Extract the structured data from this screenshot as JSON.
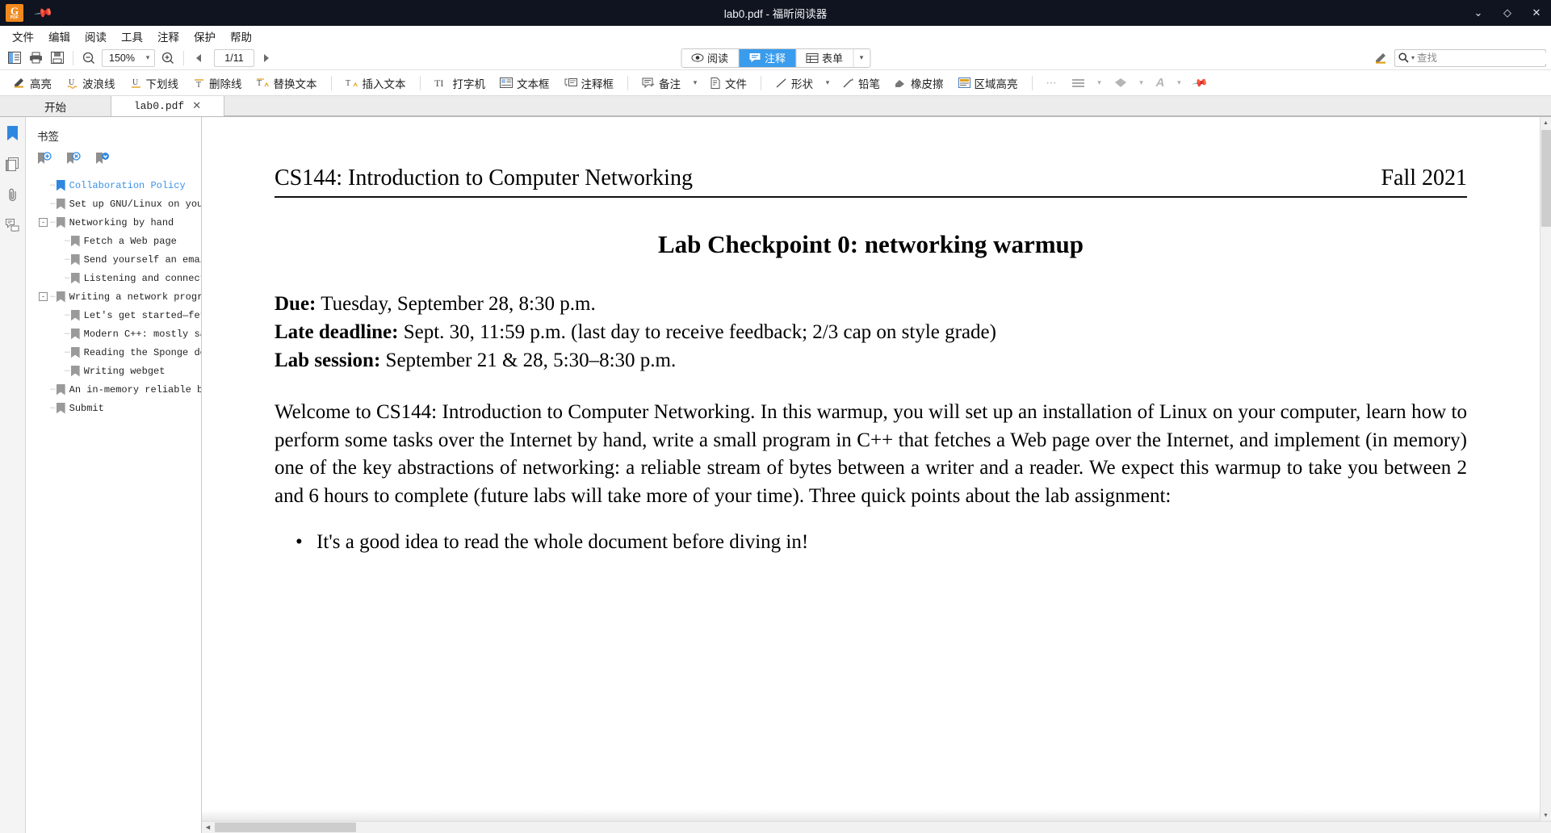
{
  "window": {
    "title": "lab0.pdf - 福昕阅读器",
    "app_icon": "pdf-logo-icon",
    "pin_icon": "pin-icon",
    "minimize_label": "⌄",
    "maximize_label": "◇",
    "close_label": "✕"
  },
  "menubar": {
    "items": [
      {
        "label": "文件",
        "name": "menu-file"
      },
      {
        "label": "编辑",
        "name": "menu-edit"
      },
      {
        "label": "阅读",
        "name": "menu-read"
      },
      {
        "label": "工具",
        "name": "menu-tools"
      },
      {
        "label": "注释",
        "name": "menu-comment"
      },
      {
        "label": "保护",
        "name": "menu-protect"
      },
      {
        "label": "帮助",
        "name": "menu-help"
      }
    ]
  },
  "toolbar": {
    "sidebar_toggle_icon": "sidebar-panel-icon",
    "print_icon": "printer-icon",
    "save_icon": "save-floppy-icon",
    "zoom_out_icon": "zoom-out-icon",
    "zoom_value": "150%",
    "zoom_dropdown_icon": "chevron-down-icon",
    "zoom_in_icon": "zoom-in-icon",
    "prev_page_icon": "triangle-left-icon",
    "page_value": "1/11",
    "next_page_icon": "triangle-right-icon",
    "highlight_pen_icon": "highlight-pen-icon",
    "search_icon": "search-icon",
    "search_dropdown_icon": "caret-down-icon",
    "search_placeholder": "查找"
  },
  "mode_tabs": {
    "items": [
      {
        "label": "阅读",
        "icon": "eye-icon",
        "active": false,
        "name": "tab-read"
      },
      {
        "label": "注释",
        "icon": "comment-bubble-icon",
        "active": true,
        "name": "tab-comment"
      },
      {
        "label": "表单",
        "icon": "form-icon",
        "active": false,
        "name": "tab-form"
      }
    ],
    "overflow_icon": "chevron-down-icon"
  },
  "annotation_toolbar": {
    "items": [
      {
        "label": "高亮",
        "icon": "highlighter-icon",
        "name": "annot-highlight",
        "color": "accent"
      },
      {
        "label": "波浪线",
        "icon": "squiggly-underline-icon",
        "name": "annot-squiggly",
        "color": "accent"
      },
      {
        "label": "下划线",
        "icon": "underline-icon",
        "name": "annot-underline",
        "color": "accent"
      },
      {
        "label": "删除线",
        "icon": "strikethrough-icon",
        "name": "annot-strikeout",
        "color": "accent"
      },
      {
        "label": "替换文本",
        "icon": "replace-text-icon",
        "name": "annot-replace-text",
        "color": "accent"
      },
      {
        "label": "插入文本",
        "icon": "insert-text-icon",
        "name": "annot-insert-text",
        "color": "accent"
      },
      {
        "label": "打字机",
        "icon": "typewriter-icon",
        "name": "annot-typewriter",
        "color": "grey"
      },
      {
        "label": "文本框",
        "icon": "textbox-icon",
        "name": "annot-textbox",
        "color": "grey"
      },
      {
        "label": "注释框",
        "icon": "callout-icon",
        "name": "annot-callout",
        "color": "grey"
      },
      {
        "label": "备注",
        "icon": "note-icon",
        "name": "annot-note",
        "color": "grey"
      },
      {
        "label": "文件",
        "icon": "file-attach-icon",
        "name": "annot-file",
        "color": "grey"
      },
      {
        "label": "形状",
        "icon": "shape-line-icon",
        "name": "annot-shape",
        "color": "grey"
      },
      {
        "label": "铅笔",
        "icon": "pencil-icon",
        "name": "annot-pencil",
        "color": "grey"
      },
      {
        "label": "橡皮擦",
        "icon": "eraser-icon",
        "name": "annot-eraser",
        "color": "grey"
      },
      {
        "label": "区域高亮",
        "icon": "area-highlight-icon",
        "name": "annot-area-highlight",
        "color": "grey"
      }
    ],
    "more_icon": "ellipsis-icon",
    "stamp_icon": "stamp-lines-icon",
    "stamp_caret_icon": "chevron-down-icon",
    "shape_fill_icon": "diamond-fill-icon",
    "shape_fill_caret_icon": "chevron-down-icon",
    "text_style_icon": "font-A-icon",
    "text_style_caret_icon": "chevron-down-icon",
    "pin_icon": "pin-icon"
  },
  "doc_tabs": {
    "home_label": "开始",
    "file_label": "lab0.pdf",
    "close_icon": "close-x-icon"
  },
  "rail": {
    "items": [
      {
        "icon": "bookmark-icon",
        "name": "rail-bookmarks",
        "active": true
      },
      {
        "icon": "pages-thumbnail-icon",
        "name": "rail-thumbnails",
        "active": false
      },
      {
        "icon": "paperclip-icon",
        "name": "rail-attachments",
        "active": false
      },
      {
        "icon": "comments-list-icon",
        "name": "rail-comments",
        "active": false
      }
    ]
  },
  "bookmarks_panel": {
    "title": "书签",
    "tools": [
      {
        "icon": "add-bookmark-icon",
        "name": "add-bookmark-button"
      },
      {
        "icon": "delete-bookmark-icon",
        "name": "delete-bookmark-button"
      },
      {
        "icon": "collapse-bookmark-icon",
        "name": "collapse-bookmarks-button"
      }
    ],
    "items": [
      {
        "label": "Collaboration Policy",
        "level": 0,
        "selected": true,
        "expander": ""
      },
      {
        "label": "Set up GNU/Linux on your ⋯",
        "level": 0,
        "selected": false,
        "expander": ""
      },
      {
        "label": "Networking by hand",
        "level": 0,
        "selected": false,
        "expander": "-"
      },
      {
        "label": "Fetch a Web page",
        "level": 1,
        "selected": false,
        "expander": ""
      },
      {
        "label": "Send yourself an email",
        "level": 1,
        "selected": false,
        "expander": ""
      },
      {
        "label": "Listening and connecting",
        "level": 1,
        "selected": false,
        "expander": ""
      },
      {
        "label": "Writing a network program⋯",
        "level": 0,
        "selected": false,
        "expander": "-"
      },
      {
        "label": "Let's get started—fet⋯",
        "level": 1,
        "selected": false,
        "expander": ""
      },
      {
        "label": "Modern C++: mostly saf⋯",
        "level": 1,
        "selected": false,
        "expander": ""
      },
      {
        "label": "Reading the Sponge doc⋯",
        "level": 1,
        "selected": false,
        "expander": ""
      },
      {
        "label": "Writing webget",
        "level": 1,
        "selected": false,
        "expander": ""
      },
      {
        "label": "An in-memory reliable byt⋯",
        "level": 0,
        "selected": false,
        "expander": ""
      },
      {
        "label": "Submit",
        "level": 0,
        "selected": false,
        "expander": ""
      }
    ]
  },
  "document": {
    "header_left": "CS144: Introduction to Computer Networking",
    "header_right": "Fall 2021",
    "title": "Lab Checkpoint 0:  networking warmup",
    "due_label": "Due:",
    "due_value": "Tuesday, September 28, 8:30 p.m.",
    "late_label": "Late deadline:",
    "late_value": "Sept. 30, 11:59 p.m. (last day to receive feedback; 2/3 cap on style grade)",
    "session_label": "Lab session:",
    "session_value": "September 21 & 28, 5:30–8:30 p.m.",
    "paragraph": "Welcome to CS144: Introduction to Computer Networking.  In this warmup, you will set up an installation of Linux on your computer, learn how to perform some tasks over the Internet by hand, write a small program in C++ that fetches a Web page over the Internet, and implement (in memory) one of the key abstractions of networking: a reliable stream of bytes between a writer and a reader.  We expect this warmup to take you between 2 and 6 hours to complete (future labs will take more of your time).  Three quick points about the lab assignment:",
    "bullet1": "It's a good idea to read the whole document before diving in!"
  },
  "scrollbars": {
    "v_up_icon": "triangle-up-icon",
    "v_down_icon": "triangle-down-icon",
    "h_left_icon": "triangle-left-icon",
    "h_right_icon": "triangle-right-icon"
  },
  "colors": {
    "accent": "#d4860b",
    "active_tab": "#3a9ced",
    "titlebar": "#0f1420",
    "bookmark_selected": "#3a92e8"
  }
}
